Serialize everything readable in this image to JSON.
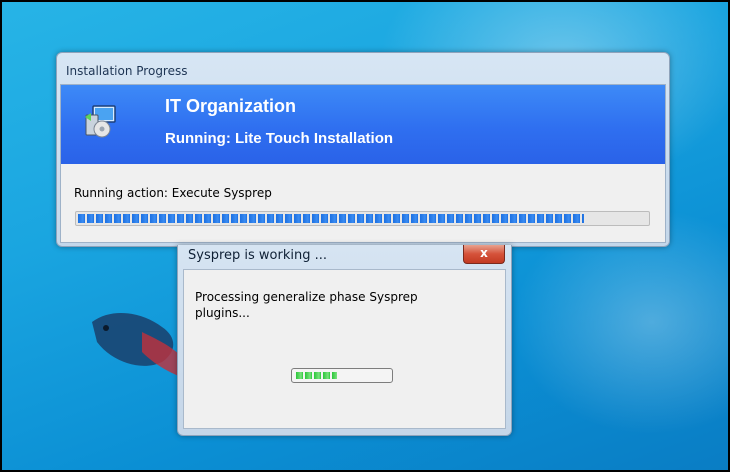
{
  "install_window": {
    "title": "Installation Progress",
    "organization": "IT Organization",
    "running_text": "Running: Lite Touch Installation",
    "action_text": "Running action: Execute Sysprep",
    "progress_fraction": 0.89,
    "icon": "deployment-computer-icon"
  },
  "sysprep_dialog": {
    "title": "Sysprep is working ...",
    "close_label": "x",
    "message": "Processing generalize phase Sysprep plugins...",
    "progress_fraction": 0.45,
    "progress_color": "#2bc63a"
  },
  "desktop": {
    "wallpaper": "windows-7-betta-fish-wallpaper",
    "accent": "#1aa5e0"
  }
}
